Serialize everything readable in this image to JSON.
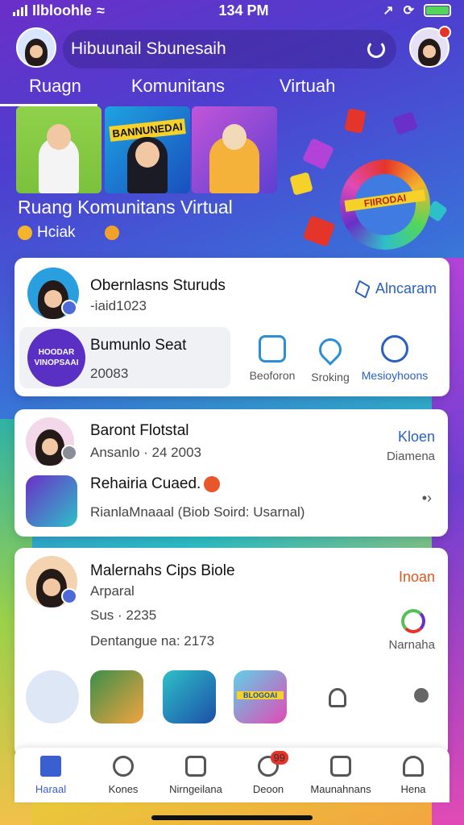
{
  "status_bar": {
    "carrier": "Ilbloohle",
    "time": "134 PM"
  },
  "header": {
    "title": "Hibuunail Sbunesaih"
  },
  "tabs": [
    {
      "label": "Ruagn"
    },
    {
      "label": "Komunitans"
    },
    {
      "label": "Virtuah"
    }
  ],
  "banner": {
    "thumb2_text": "BANNUNEDAI",
    "title": "Ruang Komunitans Virtual",
    "subtitle": "Hciak",
    "game_label": "FIIRODAI"
  },
  "card1": {
    "name": "Obernlasns Sturuds",
    "meta": "-iaid1023",
    "link": "Alncaram",
    "group_logo_text": "HOODAR VINOPSAAI",
    "group_name": "Bumunlo Seat",
    "group_meta": "20083",
    "actions": [
      {
        "label": "Beoforon"
      },
      {
        "label": "Sroking"
      },
      {
        "label": "Mesioyhoons"
      }
    ]
  },
  "card2": {
    "name": "Baront Flotstal",
    "meta": "Ansanlo · 24 2003",
    "right_label": "Kloen",
    "right_sub": "Diamena",
    "item_name": "Rehairia Cuaed.",
    "item_meta": "RianlaMnaaal (Biob Soird: Usarnal)",
    "chevron": "•›"
  },
  "card3": {
    "name": "Malernahs Cips Biole",
    "line1": "Arparal",
    "line2": "Sus · 2235",
    "line3": "Dentangue na: 2173",
    "right_label": "Inoan",
    "right_sub": "Narnaha",
    "tile_text": "BLOGOAI"
  },
  "bottom_nav": [
    {
      "label": "Haraal"
    },
    {
      "label": "Kones"
    },
    {
      "label": "Nirngeilana"
    },
    {
      "label": "Deoon",
      "badge": "99"
    },
    {
      "label": "Maunahnans"
    },
    {
      "label": "Hena"
    }
  ],
  "colors": {
    "accent": "#3a5fd0",
    "link": "#2a5fc4",
    "badge": "#e5342a"
  }
}
